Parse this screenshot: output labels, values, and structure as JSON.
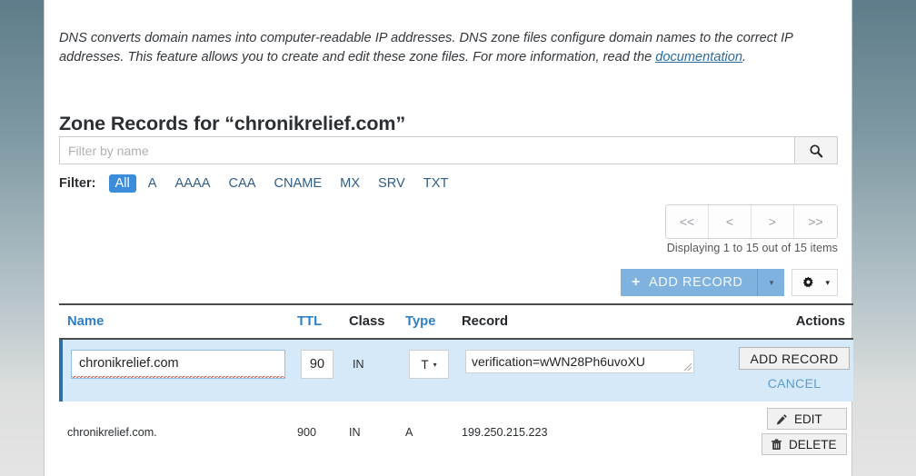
{
  "intro": {
    "text_before_link": "DNS converts domain names into computer-readable IP addresses. DNS zone files configure domain names to the correct IP addresses. This feature allows you to create and edit these zone files. For more information, read the ",
    "link_label": "documentation",
    "text_after_link": "."
  },
  "heading": "Zone Records for “chronikrelief.com”",
  "search": {
    "placeholder": "Filter by name",
    "value": "",
    "button_icon": "search-icon"
  },
  "filter": {
    "label": "Filter:",
    "items": [
      {
        "label": "All",
        "active": true
      },
      {
        "label": "A",
        "active": false
      },
      {
        "label": "AAAA",
        "active": false
      },
      {
        "label": "CAA",
        "active": false
      },
      {
        "label": "CNAME",
        "active": false
      },
      {
        "label": "MX",
        "active": false
      },
      {
        "label": "SRV",
        "active": false
      },
      {
        "label": "TXT",
        "active": false
      }
    ]
  },
  "pager": {
    "first": "<<",
    "prev": "<",
    "next": ">",
    "last": ">>",
    "status": "Displaying 1 to 15 out of 15 items"
  },
  "toolbar": {
    "add_record_label": "ADD RECORD",
    "add_plus": "+",
    "add_caret": "▾",
    "gear_icon": "gear-icon",
    "gear_caret": "▾",
    "accent_color": "#7fb2de"
  },
  "table": {
    "headers": [
      {
        "label": "Name",
        "sortable": true
      },
      {
        "label": "TTL",
        "sortable": true
      },
      {
        "label": "Class",
        "sortable": false
      },
      {
        "label": "Type",
        "sortable": true
      },
      {
        "label": "Record",
        "sortable": false
      },
      {
        "label": "Actions",
        "sortable": false
      }
    ],
    "edit_row": {
      "name_value": "chronikrelief.com",
      "ttl_value": "90",
      "class_value": "IN",
      "type_value": "T",
      "type_caret": "▾",
      "record_value": "verification=wWN28Ph6uvoXU",
      "add_button_label": "ADD RECORD",
      "cancel_label": "CANCEL",
      "highlight_color": "#d6e9f8",
      "border_color": "#2f6fa5"
    },
    "rows": [
      {
        "name": "chronikrelief.com.",
        "ttl": "900",
        "class": "IN",
        "type": "A",
        "record": "199.250.215.223",
        "edit_label": "EDIT",
        "delete_label": "DELETE",
        "edit_icon": "pencil-icon",
        "delete_icon": "trash-icon"
      }
    ]
  }
}
